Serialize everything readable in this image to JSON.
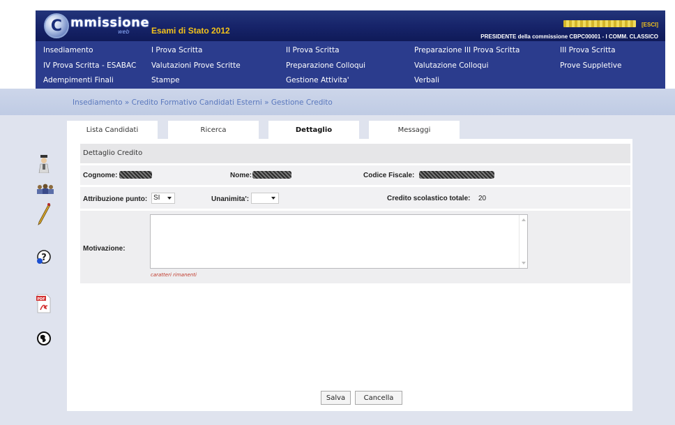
{
  "header": {
    "logo_text": "mmissione",
    "logo_sub": "web",
    "exam_title": "Esami di Stato 2012",
    "logout": "[ESCI]",
    "role": "PRESIDENTE della commissione CBPC00001 - I COMM. CLASSICO"
  },
  "menu": {
    "items": [
      {
        "label": "Insediamento"
      },
      {
        "label": "I Prova Scritta"
      },
      {
        "label": "II Prova Scritta"
      },
      {
        "label": "Preparazione III Prova Scritta"
      },
      {
        "label": "III Prova Scritta"
      },
      {
        "label": "IV Prova Scritta - ESABAC"
      },
      {
        "label": "Valutazioni Prove Scritte"
      },
      {
        "label": "Preparazione Colloqui"
      },
      {
        "label": "Valutazione Colloqui"
      },
      {
        "label": "Prove Suppletive"
      },
      {
        "label": "Adempimenti Finali"
      },
      {
        "label": "Stampe"
      },
      {
        "label": "Gestione Attivita'"
      },
      {
        "label": "Verbali"
      }
    ]
  },
  "breadcrumb": "Insediamento » Credito Formativo Candidati Esterni » Gestione Credito",
  "tabs": [
    {
      "label": "Lista Candidati"
    },
    {
      "label": "Ricerca"
    },
    {
      "label": "Dettaglio"
    },
    {
      "label": "Messaggi"
    }
  ],
  "detail": {
    "section_title": "Dettaglio Credito",
    "cognome_label": "Cognome:",
    "nome_label": "Nome:",
    "cf_label": "Codice Fiscale:",
    "attribuzione_label": "Attribuzione punto:",
    "attribuzione_value": "SI",
    "unanimita_label": "Unanimita':",
    "unanimita_value": "",
    "credito_label": "Credito scolastico totale:",
    "credito_value": "20",
    "motivazione_label": "Motivazione:",
    "remaining_text": "caratteri rimanenti"
  },
  "buttons": {
    "save": "Salva",
    "cancel": "Cancella"
  },
  "colors": {
    "header_bg": "#17246a",
    "menu_bg": "#2b3c8d",
    "accent_yellow": "#f2c21b",
    "breadcrumb_text": "#5a78bd"
  },
  "side_icons": [
    "professor-icon",
    "commission-icon",
    "pen-icon",
    "help-icon",
    "pdf-icon",
    "globe-icon"
  ]
}
